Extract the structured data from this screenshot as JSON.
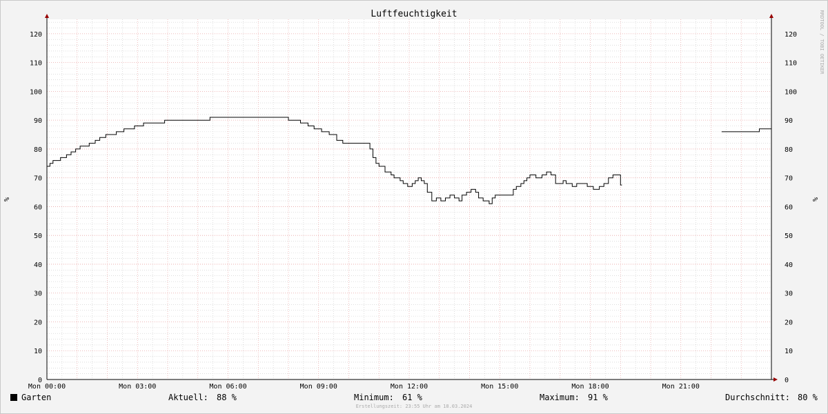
{
  "chart_data": {
    "type": "line",
    "title": "Luftfeuchtigkeit",
    "ylabel": "%",
    "ylim": [
      0,
      125
    ],
    "y_ticks": [
      0,
      10,
      20,
      30,
      40,
      50,
      60,
      70,
      80,
      90,
      100,
      110,
      120
    ],
    "xlim": [
      "Mon 00:00",
      "Mon 24:00"
    ],
    "x_ticks": [
      "Mon 00:00",
      "Mon 03:00",
      "Mon 06:00",
      "Mon 09:00",
      "Mon 12:00",
      "Mon 15:00",
      "Mon 18:00",
      "Mon 21:00"
    ],
    "x_tick_hours": [
      0,
      3,
      6,
      9,
      12,
      15,
      18,
      21
    ],
    "grid": true,
    "watermark": "RRDTOOL / TOBI OETIKER",
    "colors": {
      "line": "#000000",
      "major_grid": "#e8a0a0",
      "minor_grid": "#c8c8c8",
      "axis_arrow": "#990000",
      "plot_bg": "#ffffff"
    },
    "series": [
      {
        "name": "Garten",
        "segments": [
          [
            [
              0.0,
              74
            ],
            [
              0.1,
              75
            ],
            [
              0.2,
              76
            ],
            [
              0.45,
              77
            ],
            [
              0.65,
              78
            ],
            [
              0.8,
              79
            ],
            [
              0.95,
              80
            ],
            [
              1.1,
              81
            ],
            [
              1.4,
              82
            ],
            [
              1.6,
              83
            ],
            [
              1.75,
              84
            ],
            [
              1.95,
              85
            ],
            [
              2.3,
              86
            ],
            [
              2.55,
              87
            ],
            [
              2.9,
              88
            ],
            [
              3.2,
              89
            ],
            [
              3.9,
              90
            ],
            [
              5.4,
              91
            ],
            [
              8.0,
              90
            ],
            [
              8.4,
              89
            ],
            [
              8.65,
              88
            ],
            [
              8.85,
              87
            ],
            [
              9.1,
              86
            ],
            [
              9.35,
              85
            ],
            [
              9.6,
              83
            ],
            [
              9.8,
              82
            ],
            [
              10.6,
              82
            ],
            [
              10.7,
              80
            ],
            [
              10.8,
              77
            ],
            [
              10.9,
              75
            ],
            [
              11.0,
              74
            ],
            [
              11.2,
              72
            ],
            [
              11.4,
              71
            ],
            [
              11.5,
              70
            ],
            [
              11.7,
              69
            ],
            [
              11.8,
              68
            ],
            [
              11.95,
              67
            ],
            [
              12.1,
              68
            ],
            [
              12.2,
              69
            ],
            [
              12.3,
              70
            ],
            [
              12.4,
              69
            ],
            [
              12.5,
              68
            ],
            [
              12.6,
              65
            ],
            [
              12.75,
              62
            ],
            [
              12.9,
              63
            ],
            [
              13.05,
              62
            ],
            [
              13.2,
              63
            ],
            [
              13.35,
              64
            ],
            [
              13.5,
              63
            ],
            [
              13.65,
              62
            ],
            [
              13.75,
              64
            ],
            [
              13.9,
              65
            ],
            [
              14.05,
              66
            ],
            [
              14.2,
              65
            ],
            [
              14.3,
              63
            ],
            [
              14.45,
              62
            ],
            [
              14.65,
              61
            ],
            [
              14.75,
              63
            ],
            [
              14.85,
              64
            ],
            [
              15.1,
              64
            ],
            [
              15.3,
              64
            ],
            [
              15.45,
              66
            ],
            [
              15.55,
              67
            ],
            [
              15.7,
              68
            ],
            [
              15.8,
              69
            ],
            [
              15.9,
              70
            ],
            [
              16.0,
              71
            ],
            [
              16.2,
              70
            ],
            [
              16.4,
              71
            ],
            [
              16.55,
              72
            ],
            [
              16.7,
              71
            ],
            [
              16.85,
              68
            ],
            [
              17.0,
              68
            ],
            [
              17.1,
              69
            ],
            [
              17.2,
              68
            ],
            [
              17.4,
              67
            ],
            [
              17.55,
              68
            ],
            [
              17.7,
              68
            ],
            [
              17.9,
              67
            ],
            [
              18.1,
              66
            ],
            [
              18.3,
              67
            ],
            [
              18.45,
              68
            ],
            [
              18.6,
              70
            ],
            [
              18.75,
              71
            ],
            [
              18.95,
              71
            ],
            [
              19.0,
              67.5
            ],
            [
              19.05,
              67.5
            ]
          ],
          [
            [
              22.35,
              86
            ],
            [
              22.5,
              86
            ],
            [
              23.5,
              86
            ],
            [
              23.6,
              87
            ],
            [
              24.2,
              87
            ],
            [
              24.3,
              88
            ],
            [
              24.4,
              88
            ]
          ]
        ]
      }
    ]
  },
  "footer": {
    "legend_name": "Garten",
    "aktuell_label": "Aktuell:",
    "aktuell_value": "88 %",
    "minimum_label": "Minimum:",
    "minimum_value": "61 %",
    "maximum_label": "Maximum:",
    "maximum_value": "91 %",
    "durchschnitt_label": "Durchschnitt:",
    "durchschnitt_value": "80 %",
    "credit": "Erstellungszeit: 23:55 Uhr am 18.03.2024"
  }
}
